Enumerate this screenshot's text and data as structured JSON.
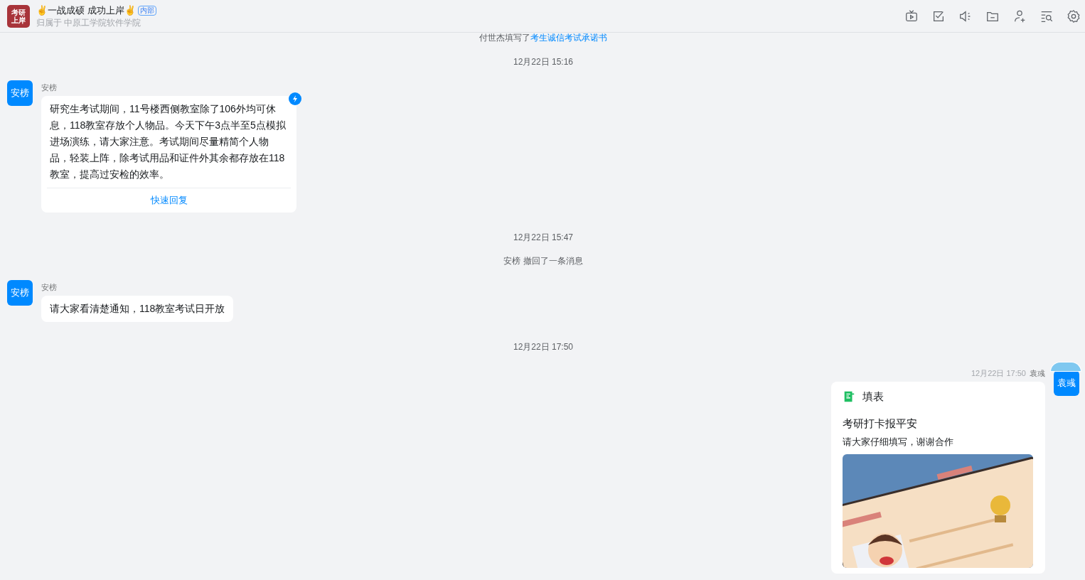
{
  "header": {
    "logo_lines": [
      "考研",
      "上岸"
    ],
    "title": "✌一战成硕 成功上岸✌",
    "badge": "内部",
    "subtitle": "归属于 中原工学院软件学院"
  },
  "messages": [
    {
      "kind": "system",
      "text": "付世杰填写了",
      "link": "考生诚信考试承诺书"
    },
    {
      "kind": "time",
      "text": "12月22日 15:16"
    },
    {
      "kind": "incoming",
      "avatar": "安榜",
      "sender": "安榜",
      "text": "研究生考试期间，11号楼西侧教室除了106外均可休息，118教室存放个人物品。今天下午3点半至5点模拟进场演练，请大家注意。考试期间尽量精简个人物品，轻装上阵，除考试用品和证件外其余都存放在118教室，提高过安检的效率。",
      "ding": true,
      "quick_reply": "快速回复"
    },
    {
      "kind": "time",
      "text": "12月22日 15:47"
    },
    {
      "kind": "system",
      "text": "安榜 撤回了一条消息"
    },
    {
      "kind": "incoming",
      "avatar": "安榜",
      "sender": "安榜",
      "text": "请大家看清楚通知，118教室考试日开放",
      "ding": false
    },
    {
      "kind": "time",
      "text": "12月22日 17:50"
    },
    {
      "kind": "outgoing_card",
      "time": "12月22日 17:50",
      "sender": "袁彧",
      "avatar": "袁彧",
      "card_type": "填表",
      "title": "考研打卡报平安",
      "description": "请大家仔细填写，谢谢合作"
    }
  ]
}
